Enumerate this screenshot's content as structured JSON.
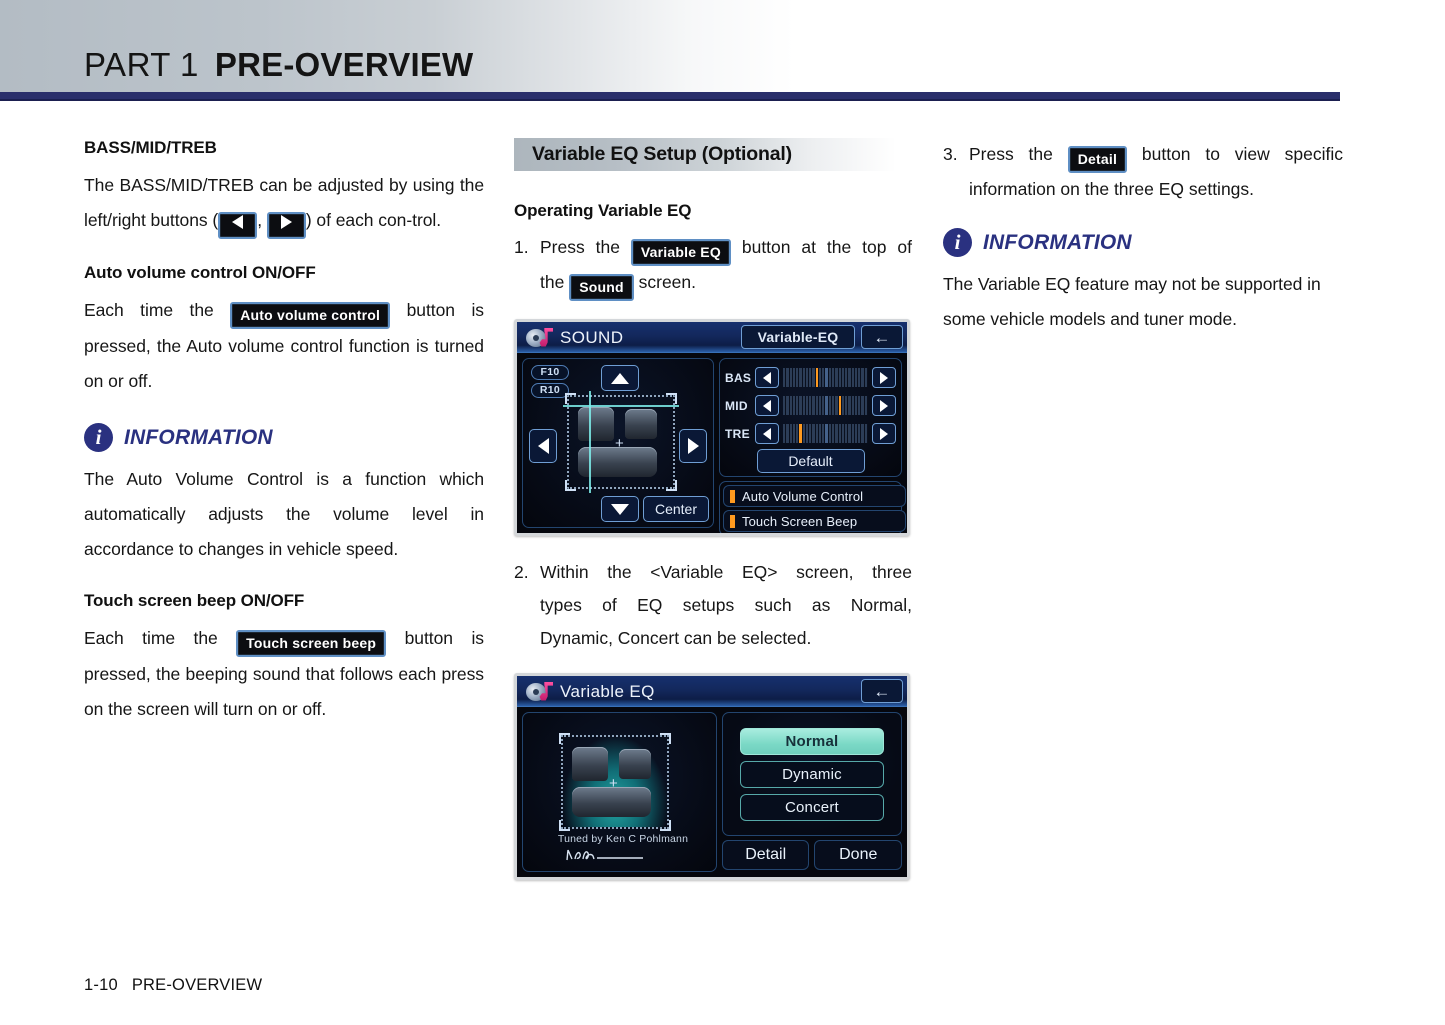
{
  "header": {
    "part_label": "PART 1",
    "section_title": "PRE-OVERVIEW"
  },
  "footer": {
    "page_number": "1-10",
    "section": "PRE-OVERVIEW"
  },
  "column_left": {
    "heading_bass": "BASS/MID/TREB",
    "bass_text_1": "The BASS/MID/TREB can be adjusted by using the left/right buttons (",
    "bass_text_2": ", ",
    "bass_text_3": ") of each con-trol.",
    "heading_avc": "Auto volume control ON/OFF",
    "avc_text_1": "Each time the",
    "avc_chip": "Auto volume control",
    "avc_text_2": "button is pressed, the Auto volume control function is turned on or off.",
    "info_label": "INFORMATION",
    "info_icon": "info-i",
    "info_text": "The Auto Volume Control is a function which automatically adjusts the volume level in accordance to changes in vehicle speed.",
    "heading_beep": "Touch screen beep ON/OFF",
    "beep_text_1": "Each time the",
    "beep_chip": "Touch screen beep",
    "beep_text_2": "button is pressed, the beeping sound that follows each press on the screen will turn on or off."
  },
  "column_middle": {
    "band_title": "Variable EQ Setup (Optional)",
    "heading_operating": "Operating Variable EQ",
    "step1_num": "1.",
    "step1_a": "Press the",
    "step1_chip1": "Variable EQ",
    "step1_b": "button at the top of",
    "step1_c": "the",
    "step1_chip2": "Sound",
    "step1_d": "screen.",
    "step2_num": "2.",
    "step2_line1": "Within the <Variable EQ> screen, three",
    "step2_line2": "types of EQ setups such as Normal,",
    "step2_line3": "Dynamic, Concert can be selected."
  },
  "column_right": {
    "step3_num": "3.",
    "step3_a": "Press the",
    "step3_chip": "Detail",
    "step3_b": "button to view specific",
    "step3_c": "information on the three EQ settings.",
    "info_label": "INFORMATION",
    "info_icon": "info-i",
    "info_text": "The Variable EQ feature may not be supported in some vehicle models and tuner mode."
  },
  "sound_screen": {
    "title": "SOUND",
    "logo_icon": "sound-disc-note-icon",
    "variable_eq_button": "Variable-EQ",
    "back_button_icon": "back-arrow-icon",
    "back_button_glyph": "←",
    "front_tag": "F10",
    "rear_tag": "R10",
    "up_icon": "triangle-up-icon",
    "down_icon": "triangle-down-icon",
    "left_icon": "triangle-left-icon",
    "right_icon": "triangle-right-icon",
    "center_button": "Center",
    "eq_rows": [
      {
        "label": "BAS",
        "value_pct": 40
      },
      {
        "label": "MID",
        "value_pct": 66
      },
      {
        "label": "TRE",
        "value_pct": 18
      }
    ],
    "default_button": "Default",
    "toggles": [
      {
        "label": "Auto Volume Control",
        "led": "on"
      },
      {
        "label": "Touch Screen Beep",
        "led": "on"
      }
    ]
  },
  "variable_eq_screen": {
    "title": "Variable EQ",
    "logo_icon": "sound-disc-note-icon",
    "back_button_icon": "back-arrow-icon",
    "back_button_glyph": "←",
    "tuned_by": "Tuned by Ken C Pohlmann",
    "signature_icon": "signature-icon",
    "options": [
      {
        "label": "Normal",
        "selected": true
      },
      {
        "label": "Dynamic",
        "selected": false
      },
      {
        "label": "Concert",
        "selected": false
      }
    ],
    "actions": [
      {
        "label": "Detail"
      },
      {
        "label": "Done"
      }
    ]
  },
  "colors": {
    "rule_navy": "#2a2f6b",
    "info_navy": "#2a3180",
    "lcd_title_blue": "#13285c",
    "lcd_border_blue": "#6f9ed4",
    "eq_marker_orange": "#ff9a1f",
    "selected_teal": "#7bd9c6"
  }
}
